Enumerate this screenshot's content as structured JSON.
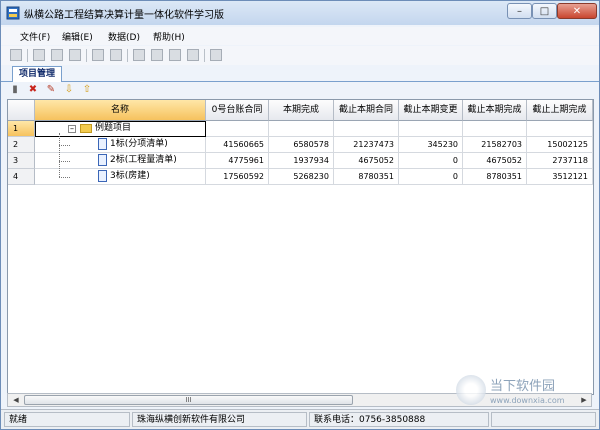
{
  "window": {
    "title": "纵横公路工程结算决算计量一体化软件学习版"
  },
  "menu": [
    {
      "label": "文件(F)"
    },
    {
      "label": "编辑(E)"
    },
    {
      "label": "数据(D)"
    },
    {
      "label": "帮助(H)"
    }
  ],
  "tabs": [
    {
      "label": "项目管理"
    }
  ],
  "grid": {
    "columns": [
      {
        "label": "名称"
      },
      {
        "label": "0号台账合同"
      },
      {
        "label": "本期完成"
      },
      {
        "label": "截止本期合同"
      },
      {
        "label": "截止本期变更"
      },
      {
        "label": "截止本期完成"
      },
      {
        "label": "截止上期完成"
      }
    ],
    "rows": [
      {
        "num": "1",
        "name": "例题项目",
        "values": [
          "",
          "",
          "",
          "",
          "",
          ""
        ]
      },
      {
        "num": "2",
        "name": "1标(分项清单)",
        "values": [
          "41560665",
          "6580578",
          "21237473",
          "345230",
          "21582703",
          "15002125"
        ]
      },
      {
        "num": "3",
        "name": "2标(工程量清单)",
        "values": [
          "4775961",
          "1937934",
          "4675052",
          "0",
          "4675052",
          "2737118"
        ]
      },
      {
        "num": "4",
        "name": "3标(房建)",
        "values": [
          "17560592",
          "5268230",
          "8780351",
          "0",
          "8780351",
          "3512121"
        ]
      }
    ]
  },
  "scrollbar": {
    "thumb_label": "III"
  },
  "status": {
    "state": "就绪",
    "company": "珠海纵横创新软件有限公司",
    "phone": "联系电话：0756-3850888"
  },
  "watermark": {
    "text": "当下软件园",
    "url": "www.downxia.com"
  },
  "icons": {
    "app": "app-icon",
    "window": [
      "minimize-icon",
      "maximize-icon",
      "close-icon"
    ],
    "tree": [
      "folder-icon",
      "document-icon"
    ]
  },
  "colors": {
    "selection": "#f6c25e",
    "titlebar": "#c3d6ee",
    "tab_text": "#102a6a"
  }
}
